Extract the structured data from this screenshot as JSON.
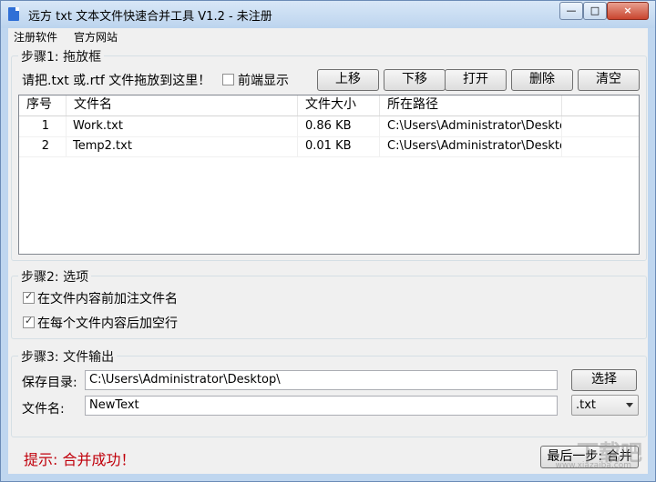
{
  "window": {
    "title": "远方 txt 文本文件快速合并工具 V1.2 - 未注册",
    "controls": {
      "minimize": "—",
      "maximize": "□",
      "close": "×"
    }
  },
  "menu": {
    "items": [
      "注册软件",
      "官方网站"
    ]
  },
  "step1": {
    "title": "步骤1: 拖放框",
    "hint": "请把.txt 或.rtf 文件拖放到这里！",
    "front_display": "前端显示",
    "buttons": {
      "up": "上移",
      "down": "下移",
      "open": "打开",
      "delete": "删除",
      "clear": "清空"
    },
    "table": {
      "headers": [
        "序号",
        "文件名",
        "文件大小",
        "所在路径"
      ],
      "rows": [
        {
          "index": "1",
          "name": "Work.txt",
          "size": "0.86 KB",
          "path": "C:\\Users\\Administrator\\Desktop\\"
        },
        {
          "index": "2",
          "name": "Temp2.txt",
          "size": "0.01 KB",
          "path": "C:\\Users\\Administrator\\Desktop\\"
        }
      ]
    }
  },
  "step2": {
    "title": "步骤2: 选项",
    "option1": "在文件内容前加注文件名",
    "option2": "在每个文件内容后加空行"
  },
  "step3": {
    "title": "步骤3: 文件输出",
    "save_dir_label": "保存目录:",
    "save_dir_value": "C:\\Users\\Administrator\\Desktop\\",
    "choose_label": "选择",
    "filename_label": "文件名:",
    "filename_value": "NewText",
    "extension": ".txt"
  },
  "footer": {
    "status": "提示: 合并成功！",
    "merge_label": "最后一步: 合并"
  },
  "watermark": {
    "logo": "下载吧",
    "url": "www.xiazaiba.com"
  },
  "colors": {
    "status": "#c0000b",
    "window_frame": "#6b8bb6",
    "client": "#f0f0f0"
  }
}
